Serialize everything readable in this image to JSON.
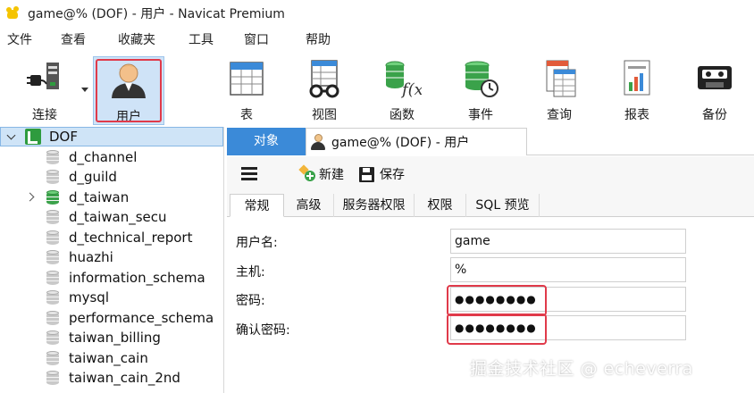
{
  "window": {
    "title": "game@% (DOF) - 用户 - Navicat Premium"
  },
  "menu": [
    "文件",
    "查看",
    "收藏夹",
    "工具",
    "窗口",
    "帮助"
  ],
  "toolbar": [
    {
      "label": "连接",
      "icon": "plug-icon"
    },
    {
      "label": "用户",
      "icon": "user-icon",
      "active": true
    },
    {
      "label": "表",
      "icon": "table-icon"
    },
    {
      "label": "视图",
      "icon": "view-icon"
    },
    {
      "label": "函数",
      "icon": "function-icon"
    },
    {
      "label": "事件",
      "icon": "event-icon"
    },
    {
      "label": "查询",
      "icon": "query-icon"
    },
    {
      "label": "报表",
      "icon": "report-icon"
    },
    {
      "label": "备份",
      "icon": "backup-icon"
    }
  ],
  "tree": {
    "root": "DOF",
    "items": [
      {
        "label": "d_channel"
      },
      {
        "label": "d_guild"
      },
      {
        "label": "d_taiwan",
        "open": true
      },
      {
        "label": "d_taiwan_secu"
      },
      {
        "label": "d_technical_report"
      },
      {
        "label": "huazhi"
      },
      {
        "label": "information_schema"
      },
      {
        "label": "mysql"
      },
      {
        "label": "performance_schema"
      },
      {
        "label": "taiwan_billing"
      },
      {
        "label": "taiwan_cain"
      },
      {
        "label": "taiwan_cain_2nd"
      }
    ]
  },
  "doc_tabs": {
    "objects": "对象",
    "user_tab": "game@% (DOF) - 用户"
  },
  "subtoolbar": {
    "new": "新建",
    "save": "保存"
  },
  "inner_tabs": [
    "常规",
    "高级",
    "服务器权限",
    "权限",
    "SQL 预览"
  ],
  "form": {
    "username_label": "用户名:",
    "username_value": "game",
    "host_label": "主机:",
    "host_value": "%",
    "password_label": "密码:",
    "password_value": "●●●●●●●●",
    "confirm_label": "确认密码:",
    "confirm_value": "●●●●●●●●"
  },
  "watermark": "掘金技术社区 @ echeverra",
  "colors": {
    "accent": "#3b8ad8",
    "highlight": "#e03a4a",
    "selection": "#cfe4f7",
    "db_green": "#3aa24a"
  }
}
